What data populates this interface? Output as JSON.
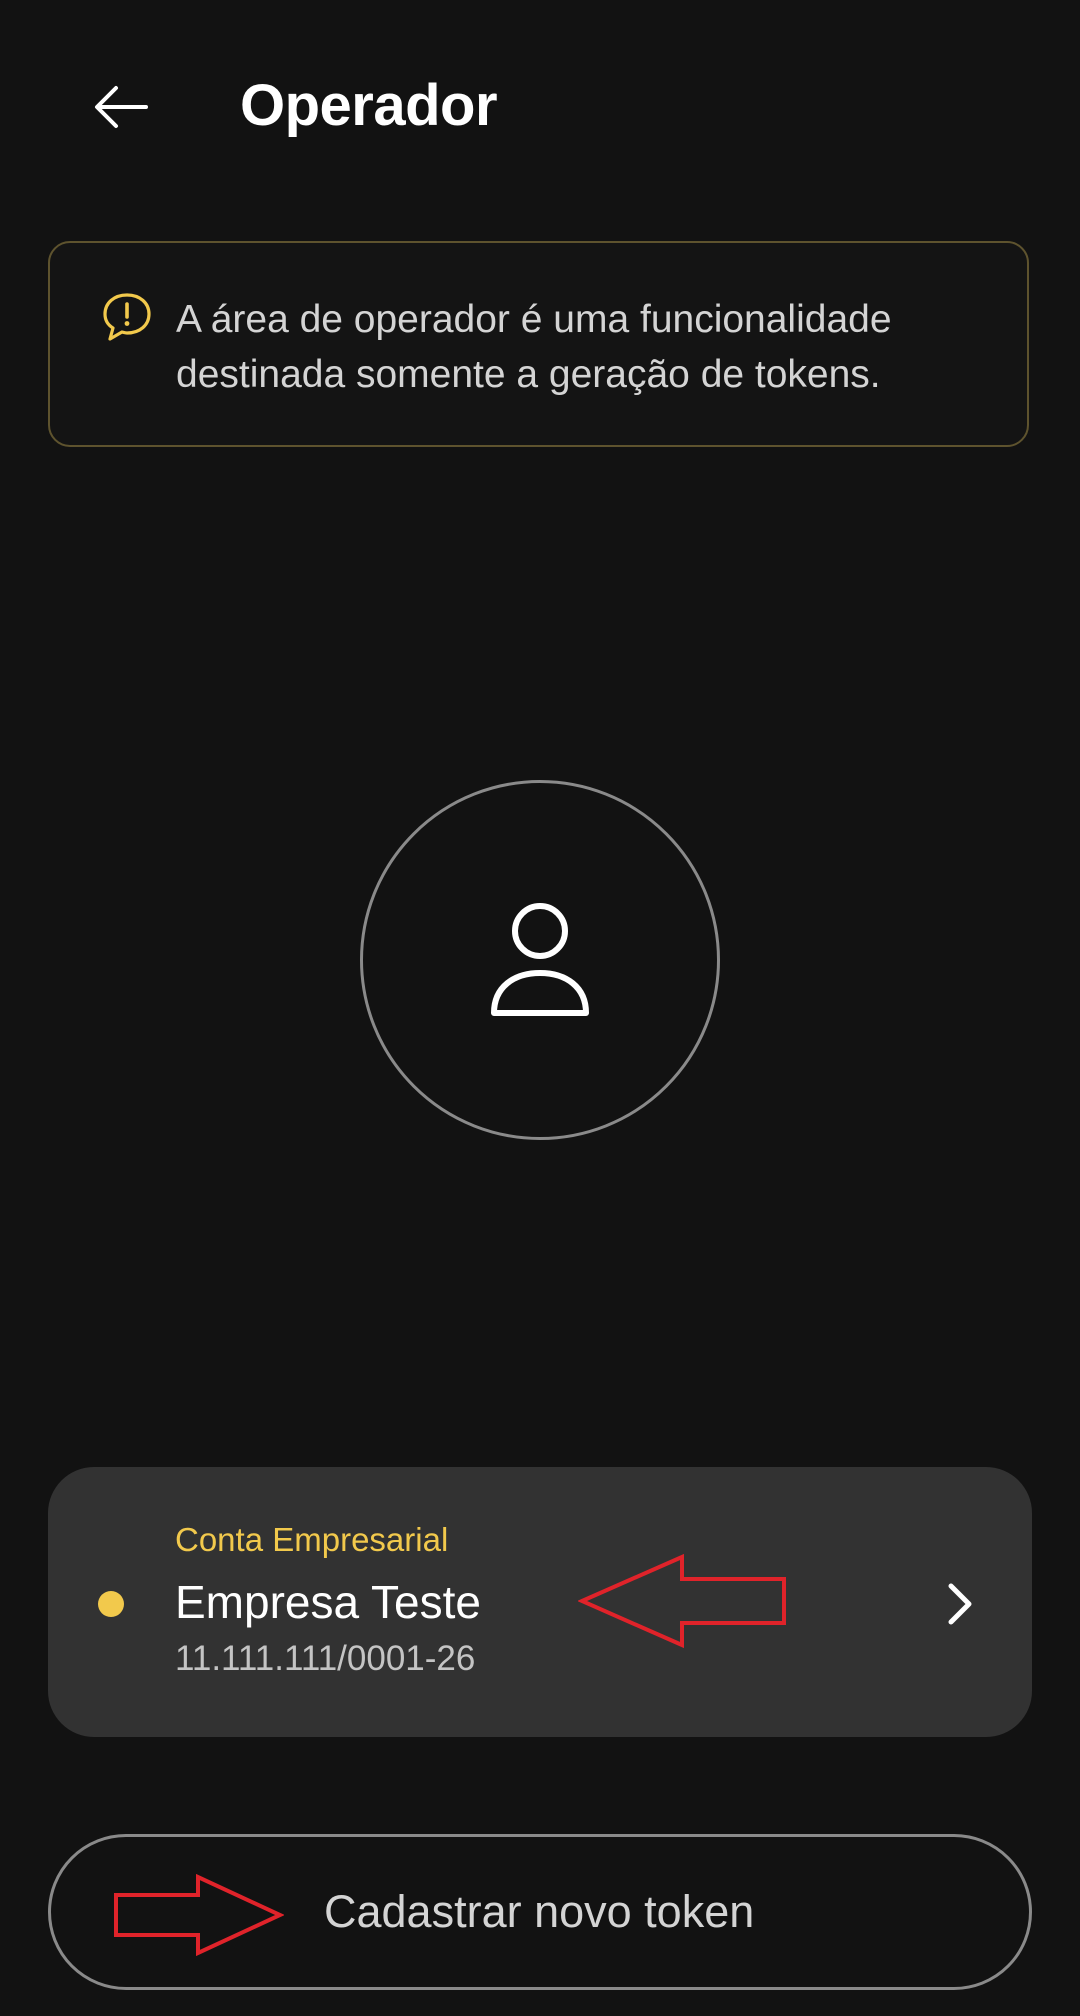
{
  "header": {
    "back_icon": "arrow-left-icon",
    "title": "Operador"
  },
  "banner": {
    "icon": "alert-message-icon",
    "text": "A área de operador é uma funcionalidade destinada somente a geração de tokens.",
    "border_color": "#5e532e",
    "icon_color": "#f2c94c"
  },
  "avatar": {
    "icon": "user-icon"
  },
  "account": {
    "type": "Conta Empresarial",
    "name": "Empresa Teste",
    "id": "11.111.111/0001-26",
    "status_color": "#f2c94c",
    "chevron_icon": "chevron-right-icon"
  },
  "actions": {
    "register_token_label": "Cadastrar novo token"
  },
  "colors": {
    "background": "#121212",
    "card": "#323232",
    "accent": "#f2c94c",
    "annotation": "#e0232a"
  }
}
